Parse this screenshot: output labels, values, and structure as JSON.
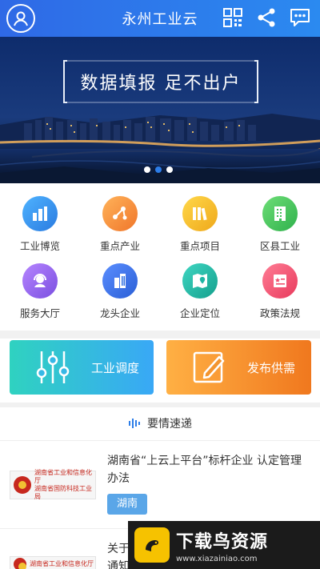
{
  "header": {
    "title": "永州工业云",
    "left_icon": "user-avatar-icon",
    "right_icons": [
      "qr-code-icon",
      "share-icon",
      "message-icon"
    ]
  },
  "banner": {
    "headline": "数据填报 足不出户",
    "slide_count": 3,
    "active_slide": 2
  },
  "grid": {
    "items": [
      {
        "label": "工业博览",
        "icon": "building-blocks-icon",
        "color": "#2e8be0"
      },
      {
        "label": "重点产业",
        "icon": "network-nodes-icon",
        "color": "#f28a2e"
      },
      {
        "label": "重点项目",
        "icon": "books-icon",
        "color": "#f0b51e"
      },
      {
        "label": "区县工业",
        "icon": "office-building-icon",
        "color": "#3cbf57"
      },
      {
        "label": "服务大厅",
        "icon": "customer-service-icon",
        "color": "#8e5ce0"
      },
      {
        "label": "龙头企业",
        "icon": "skyscraper-icon",
        "color": "#2f6fe0"
      },
      {
        "label": "企业定位",
        "icon": "map-pin-icon",
        "color": "#1fb6a4"
      },
      {
        "label": "政策法规",
        "icon": "document-star-icon",
        "color": "#f0506e"
      }
    ]
  },
  "actions": {
    "dispatch_label": "工业调度",
    "supply_label": "发布供需"
  },
  "news_header": {
    "label": "要情速递"
  },
  "news": [
    {
      "thumb_line1": "湖南省工业和信息化厅",
      "thumb_line2": "湖南省国防科技工业局",
      "title": "湖南省“上云上平台”标杆企业 认定管理办法",
      "tag": "湖南"
    },
    {
      "thumb_line1": "湖南省工业和信息化厅",
      "thumb_line2": "",
      "title": "关于",
      "title_line2": "通知",
      "tag": ""
    }
  ],
  "watermark": {
    "title": "下载鸟资源",
    "url": "www.xiazainiao.com"
  }
}
